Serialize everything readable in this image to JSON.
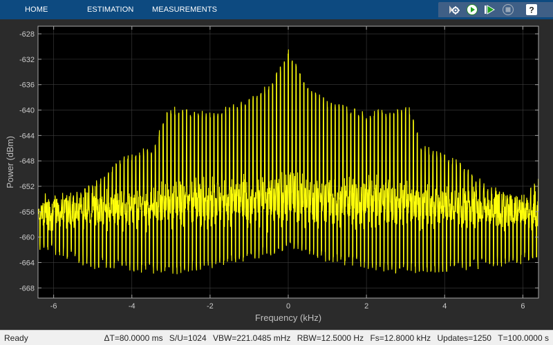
{
  "toolstrip": {
    "tabs": [
      {
        "label": "HOME"
      },
      {
        "label": "ESTIMATION"
      },
      {
        "label": "MEASUREMENTS"
      }
    ],
    "tools": [
      {
        "icon": "settings-gear-icon"
      },
      {
        "icon": "run-icon"
      },
      {
        "icon": "step-forward-icon"
      },
      {
        "icon": "stop-icon"
      },
      {
        "icon": "help-icon"
      }
    ],
    "help_glyph": "?"
  },
  "colors": {
    "trace": "#ffff0a",
    "plot_background": "#000000",
    "figure_background": "#2b2b2b",
    "axis": "#cccccc",
    "grid": "#404040",
    "toolstrip": "#0d4a80"
  },
  "chart_data": {
    "type": "line",
    "title": "",
    "xlabel": "Frequency (kHz)",
    "ylabel": "Power (dBm)",
    "xlim": [
      -6.4,
      6.4
    ],
    "ylim": [
      -669.6,
      -626.8
    ],
    "xticks": [
      -6,
      -4,
      -2,
      0,
      2,
      4,
      6
    ],
    "yticks": [
      -668,
      -664,
      -660,
      -656,
      -652,
      -648,
      -644,
      -640,
      -636,
      -632,
      -628
    ],
    "grid": true,
    "series": [
      {
        "description_color": "yellow",
        "peak_spacing_khz": 0.1,
        "envelope_peaks": [
          {
            "x": -6.4,
            "y": -656
          },
          {
            "x": -6.0,
            "y": -655
          },
          {
            "x": -5.0,
            "y": -652
          },
          {
            "x": -4.2,
            "y": -648
          },
          {
            "x": -3.4,
            "y": -646
          },
          {
            "x": -3.1,
            "y": -640
          },
          {
            "x": -2.0,
            "y": -641
          },
          {
            "x": -1.0,
            "y": -639
          },
          {
            "x": -0.4,
            "y": -636
          },
          {
            "x": 0.0,
            "y": -631
          },
          {
            "x": 0.4,
            "y": -636
          },
          {
            "x": 1.0,
            "y": -639
          },
          {
            "x": 2.0,
            "y": -641
          },
          {
            "x": 3.1,
            "y": -640
          },
          {
            "x": 3.4,
            "y": -646
          },
          {
            "x": 4.2,
            "y": -648
          },
          {
            "x": 5.0,
            "y": -652
          },
          {
            "x": 6.0,
            "y": -655
          },
          {
            "x": 6.4,
            "y": -651
          }
        ],
        "envelope_troughs": [
          {
            "x": -6.4,
            "y": -661
          },
          {
            "x": -5.0,
            "y": -664
          },
          {
            "x": -3.0,
            "y": -665
          },
          {
            "x": -1.0,
            "y": -663
          },
          {
            "x": 0.0,
            "y": -661
          },
          {
            "x": 1.0,
            "y": -663
          },
          {
            "x": 3.0,
            "y": -665
          },
          {
            "x": 5.0,
            "y": -664
          },
          {
            "x": 6.4,
            "y": -663
          }
        ]
      }
    ]
  },
  "status": {
    "ready": "Ready",
    "delta_t": "ΔT=80.0000 ms",
    "s_u": "S/U=1024",
    "vbw": "VBW=221.0485 mHz",
    "rbw": "RBW=12.5000 Hz",
    "fs": "Fs=12.8000 kHz",
    "updates": "Updates=1250",
    "t": "T=100.0000 s"
  }
}
